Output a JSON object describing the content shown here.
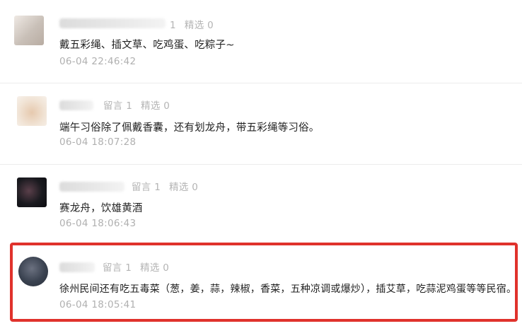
{
  "comments": [
    {
      "reply_label": "1",
      "pick_label": "精选 0",
      "text": "戴五彩绳、插文草、吃鸡蛋、吃粽子~",
      "time": "06-04 22:46:42",
      "avatar_color": "#c9c0b8"
    },
    {
      "reply_label": "留言 1",
      "pick_label": "精选 0",
      "text": "端午习俗除了佩戴香囊，还有划龙舟，带五彩绳等习俗。",
      "time": "06-04 18:07:28",
      "avatar_color": "#e6c9ae"
    },
    {
      "reply_label": "留言 1",
      "pick_label": "精选 0",
      "text": "赛龙舟，饮雄黄酒",
      "time": "06-04 18:06:43",
      "avatar_color": "#1a1a1f"
    },
    {
      "reply_label": "留言 1",
      "pick_label": "精选 0",
      "text": "徐州民间还有吃五毒菜（葱，姜，蒜，辣椒，香菜，五种凉调或爆炒），插艾草，吃蒜泥鸡蛋等等民宿。",
      "time": "06-04 18:05:41",
      "avatar_color": "#3a4250"
    }
  ],
  "highlight_color": "#e0322c"
}
